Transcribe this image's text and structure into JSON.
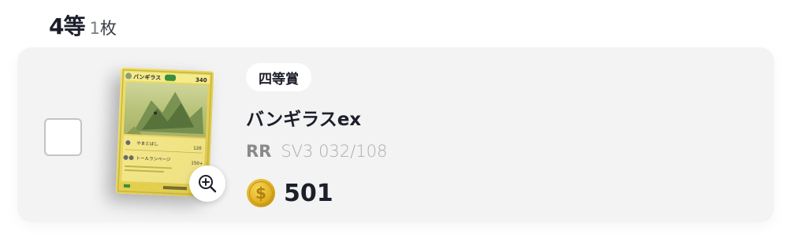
{
  "section": {
    "prize_title": "4等",
    "count_number": "1",
    "count_unit": "枚"
  },
  "item": {
    "rank_label": "四等賞",
    "card_name": "バンギラスex",
    "rarity": "RR",
    "set_code": "SV3 032/108",
    "price": "501",
    "card_art": {
      "name_text": "バンギラス",
      "hp_text": "340",
      "attack_1": "やまとばし",
      "attack_1_damage": "120",
      "attack_2": "トールランページ",
      "attack_2_damage": "150+"
    }
  },
  "icons": {
    "zoom": "zoom-in-icon",
    "coin": "coin-icon"
  },
  "colors": {
    "card_background": "#f3f3f3",
    "badge_background": "#ffffff",
    "coin_gold": "#e0b020",
    "card_yellow": "#e8d75a"
  }
}
